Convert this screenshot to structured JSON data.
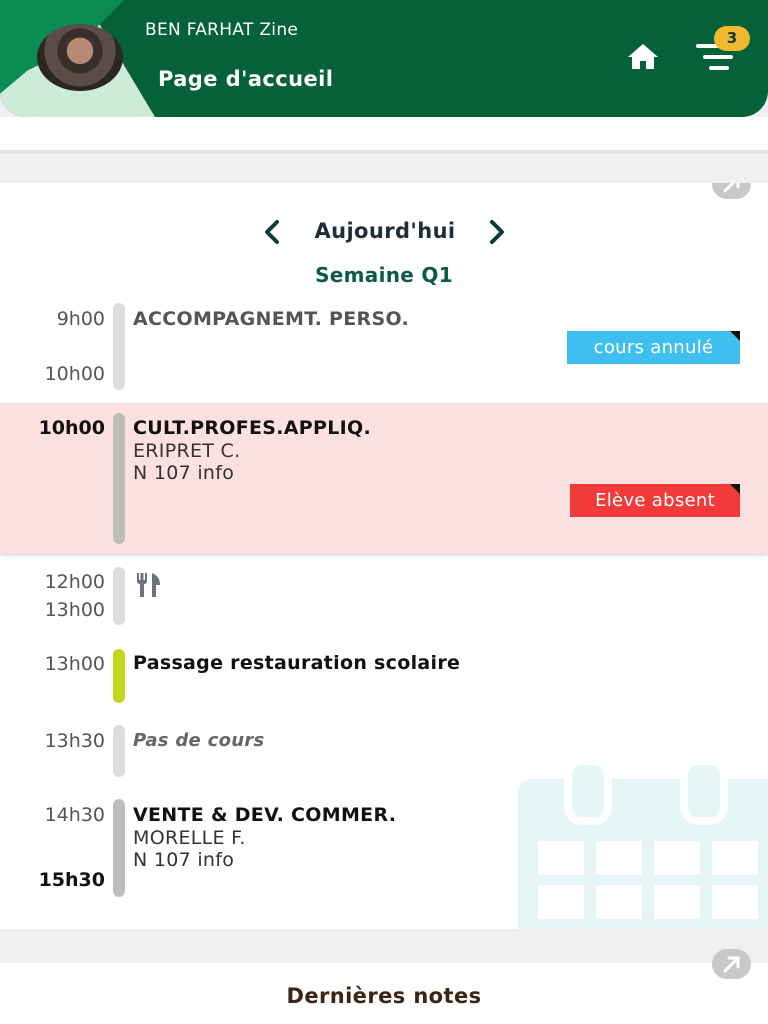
{
  "header": {
    "user_name": "BEN FARHAT Zine",
    "page_title": "Page d'accueil",
    "notification_count": "3",
    "colors": {
      "primary": "#05613a",
      "badge": "#f2b830"
    }
  },
  "timetable": {
    "day_label": "Aujourd'hui",
    "week_label": "Semaine Q1",
    "slots": [
      {
        "start": "9h00",
        "end": "10h00",
        "subject": "ACCOMPAGNEMT. PERSO.",
        "status": "cours annulé",
        "status_color": "#3fbff0"
      },
      {
        "start": "10h00",
        "subject": "CULT.PROFES.APPLIQ.",
        "teacher": "ERIPRET C.",
        "room": "N 107 info",
        "status": "Elève absent",
        "status_color": "#f23a3a"
      },
      {
        "start": "12h00",
        "end": "13h00",
        "icon": "fork-knife-icon"
      },
      {
        "start": "13h00",
        "subject": "Passage restauration scolaire"
      },
      {
        "start": "13h30",
        "subject": "Pas de cours"
      },
      {
        "start": "14h30",
        "end": "15h30",
        "subject": "VENTE & DEV. COMMER.",
        "teacher": "MORELLE F.",
        "room": "N 107 info"
      }
    ]
  },
  "notes": {
    "title": "Dernières notes"
  }
}
